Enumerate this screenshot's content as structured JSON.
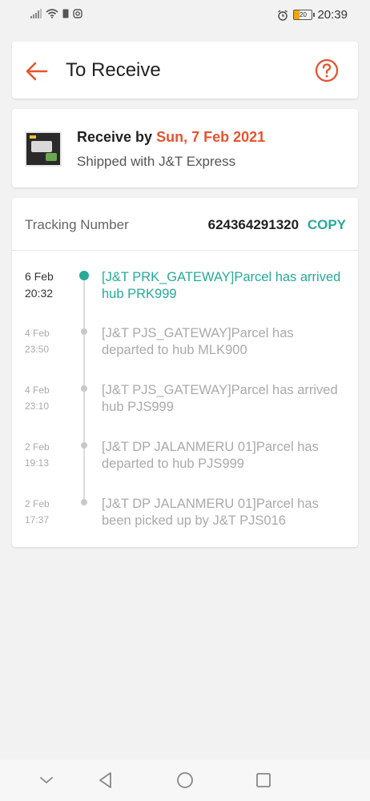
{
  "status_bar": {
    "time": "20:39",
    "battery": "20"
  },
  "header": {
    "title": "To Receive"
  },
  "delivery": {
    "receive_prefix": "Receive by",
    "receive_date": "Sun, 7 Feb 2021",
    "shipped_with": "Shipped with J&T Express"
  },
  "tracking": {
    "label": "Tracking Number",
    "number": "624364291320",
    "copy_label": "COPY",
    "events": [
      {
        "date": "6 Feb",
        "time": "20:32",
        "text": "[J&T PRK_GATEWAY]Parcel has arrived hub PRK999"
      },
      {
        "date": "4 Feb",
        "time": "23:50",
        "text": "[J&T PJS_GATEWAY]Parcel has departed to hub MLK900"
      },
      {
        "date": "4 Feb",
        "time": "23:10",
        "text": "[J&T PJS_GATEWAY]Parcel has arrived hub PJS999"
      },
      {
        "date": "2 Feb",
        "time": "19:13",
        "text": "[J&T DP JALANMERU 01]Parcel has departed to hub PJS999"
      },
      {
        "date": "2 Feb",
        "time": "17:37",
        "text": "[J&T DP JALANMERU 01]Parcel has been picked up by J&T PJS016"
      }
    ]
  },
  "icons": {
    "back": "arrow-left-icon",
    "help": "question-circle-icon",
    "nav": [
      "chevron-down-icon",
      "back-triangle-icon",
      "home-circle-icon",
      "recents-square-icon"
    ]
  },
  "colors": {
    "accent": "#e5542f",
    "teal": "#26aa99"
  }
}
